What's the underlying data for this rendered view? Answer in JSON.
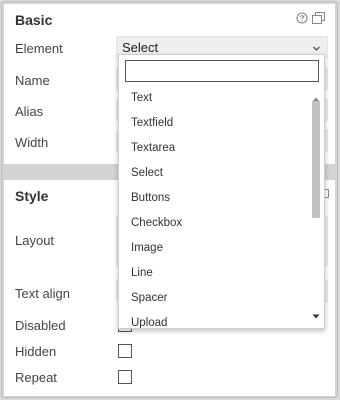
{
  "basic": {
    "title": "Basic",
    "fields": {
      "element_label": "Element",
      "name_label": "Name",
      "alias_label": "Alias",
      "width_label": "Width"
    },
    "element_select": {
      "value": "Select"
    }
  },
  "style": {
    "title": "Style",
    "layout_label": "Layout",
    "text_align_label": "Text align",
    "disabled_label": "Disabled",
    "hidden_label": "Hidden",
    "repeat_label": "Repeat"
  },
  "dropdown": {
    "search_value": "",
    "options": [
      "Text",
      "Textfield",
      "Textarea",
      "Select",
      "Buttons",
      "Checkbox",
      "Image",
      "Line",
      "Spacer",
      "Upload"
    ]
  },
  "icons": {
    "help": "help-circle-icon",
    "copy": "copy-icon",
    "chevron": "chevron-down-icon"
  }
}
